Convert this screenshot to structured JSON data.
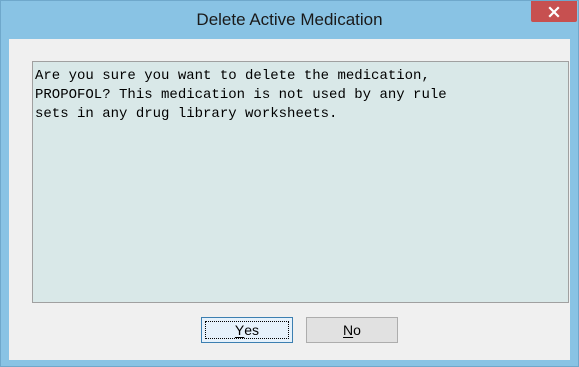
{
  "dialog": {
    "title": "Delete Active Medication",
    "close_icon": "close-icon",
    "message": "Are you sure you want to delete the medication,\nPROPOFOL? This medication is not used by any rule\nsets in any drug library worksheets.",
    "buttons": {
      "yes": {
        "accel": "Y",
        "rest": "es"
      },
      "no": {
        "accel": "N",
        "rest": "o"
      }
    }
  },
  "colors": {
    "frame": "#89c3e4",
    "close_button": "#c75050",
    "message_background": "#d9e8e8",
    "client_background": "#f0f0f0"
  }
}
